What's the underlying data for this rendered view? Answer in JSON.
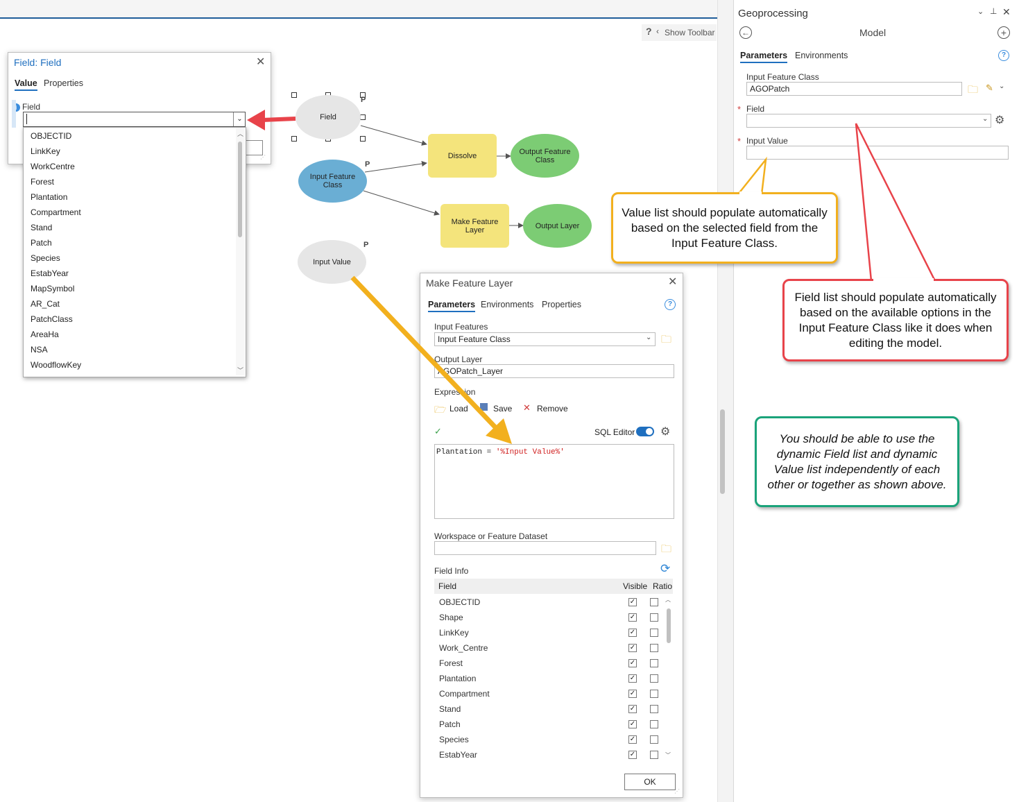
{
  "canvas": {
    "show_toolbar": "Show Toolbar",
    "help": "?"
  },
  "field_dialog": {
    "title": "Field: Field",
    "tabs": [
      "Value",
      "Properties"
    ],
    "field_label": "Field",
    "field_value": "",
    "options": [
      "OBJECTID",
      "LinkKey",
      "WorkCentre",
      "Forest",
      "Plantation",
      "Compartment",
      "Stand",
      "Patch",
      "Species",
      "EstabYear",
      "MapSymbol",
      "AR_Cat",
      "PatchClass",
      "AreaHa",
      "NSA",
      "WoodflowKey"
    ]
  },
  "model": {
    "nodes": {
      "field": "Field",
      "dissolve": "Dissolve",
      "output_feature_class": "Output Feature Class",
      "input_feature_class": "Input Feature Class",
      "make_feature_layer": "Make Feature Layer",
      "output_layer": "Output Layer",
      "input_value": "Input Value"
    },
    "p_marker": "P",
    "colors": {
      "ellipse_gray": "#e6e6e6",
      "tool_yellow": "#f4e47c",
      "output_green": "#7ccc74",
      "input_blue": "#6aaed4"
    }
  },
  "mfl_dialog": {
    "title": "Make Feature Layer",
    "tabs": [
      "Parameters",
      "Environments",
      "Properties"
    ],
    "input_features_label": "Input Features",
    "input_features_value": "Input Feature Class",
    "output_layer_label": "Output Layer",
    "output_layer_value": "AGOPatch_Layer",
    "expression_label": "Expression",
    "load": "Load",
    "save": "Save",
    "remove": "Remove",
    "sql_editor": "SQL Editor",
    "sql_prefix": "Plantation = ",
    "sql_value": "'%Input Value%'",
    "workspace_label": "Workspace or Feature Dataset",
    "field_info_label": "Field Info",
    "field_info_headers": [
      "Field",
      "Visible",
      "Ratio"
    ],
    "field_info_rows": [
      "OBJECTID",
      "Shape",
      "LinkKey",
      "Work_Centre",
      "Forest",
      "Plantation",
      "Compartment",
      "Stand",
      "Patch",
      "Species",
      "EstabYear"
    ],
    "ok": "OK"
  },
  "geoprocessing": {
    "title": "Geoprocessing",
    "model_title": "Model",
    "tabs": [
      "Parameters",
      "Environments"
    ],
    "input_feature_class_label": "Input Feature Class",
    "input_feature_class_value": "AGOPatch",
    "field_label": "Field",
    "input_value_label": "Input Value",
    "required_mark": "*"
  },
  "callouts": {
    "value_list": "Value list should populate automatically based on the selected field from the Input Feature Class.",
    "field_list": "Field list should populate automatically based on the available options in the Input Feature Class like it does when editing the model.",
    "independent": "You should be able to use the dynamic Field list and dynamic Value list independently of each other or together as shown above."
  },
  "accent_colors": {
    "yellow_callout": "#f2b01e",
    "red_callout": "#e8434a",
    "green_callout": "#1aa37a",
    "tab_blue": "#1f6fbf"
  }
}
